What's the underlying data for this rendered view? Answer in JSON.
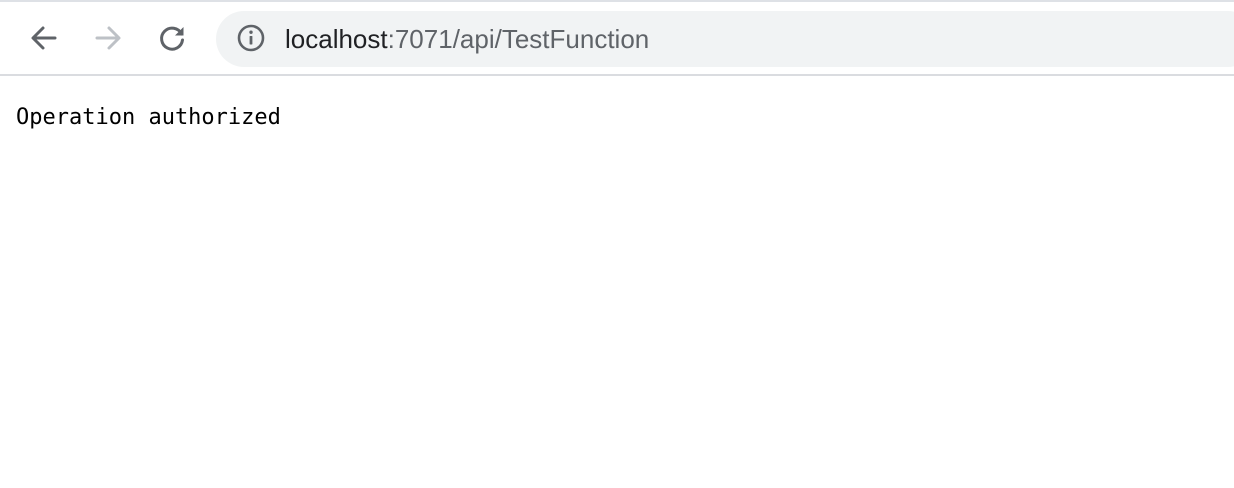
{
  "browser": {
    "nav": {
      "back_icon": "arrow-left-icon",
      "forward_icon": "arrow-right-icon",
      "reload_icon": "reload-icon"
    },
    "address_bar": {
      "info_icon": "info-circle-icon",
      "host": "localhost",
      "rest": ":7071/api/TestFunction"
    },
    "colors": {
      "icon_active": "#5f6368",
      "icon_disabled": "#bdc1c6",
      "omnibox_bg": "#f1f3f4"
    }
  },
  "page": {
    "body_text": "Operation authorized"
  }
}
